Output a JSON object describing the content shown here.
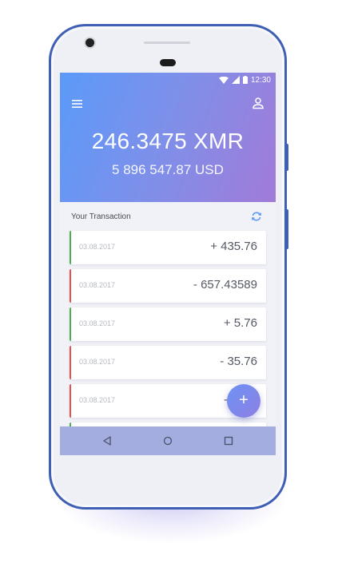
{
  "status_bar": {
    "time": "12:30"
  },
  "header": {
    "menu_icon": "hamburger-menu-icon",
    "profile_icon": "user-profile-icon",
    "balance": "246.3475 XMR",
    "balance_fiat": "5 896 547.87 USD"
  },
  "transactions": {
    "title": "Your Transaction",
    "refresh_icon": "refresh-icon",
    "items": [
      {
        "date": "03.08.2017",
        "amount": "+ 435.76",
        "direction": "in"
      },
      {
        "date": "03.08.2017",
        "amount": "- 657.43589",
        "direction": "out"
      },
      {
        "date": "03.08.2017",
        "amount": "+ 5.76",
        "direction": "in"
      },
      {
        "date": "03.08.2017",
        "amount": "- 35.76",
        "direction": "out"
      },
      {
        "date": "03.08.2017",
        "amount": "-",
        "direction": "out"
      }
    ]
  },
  "fab": {
    "label": "+"
  },
  "colors": {
    "positive": "#4cb050",
    "negative": "#e5514e",
    "header_start": "#5b9af9",
    "header_end": "#a17bd8",
    "phone_frame": "#3e5fb4"
  }
}
